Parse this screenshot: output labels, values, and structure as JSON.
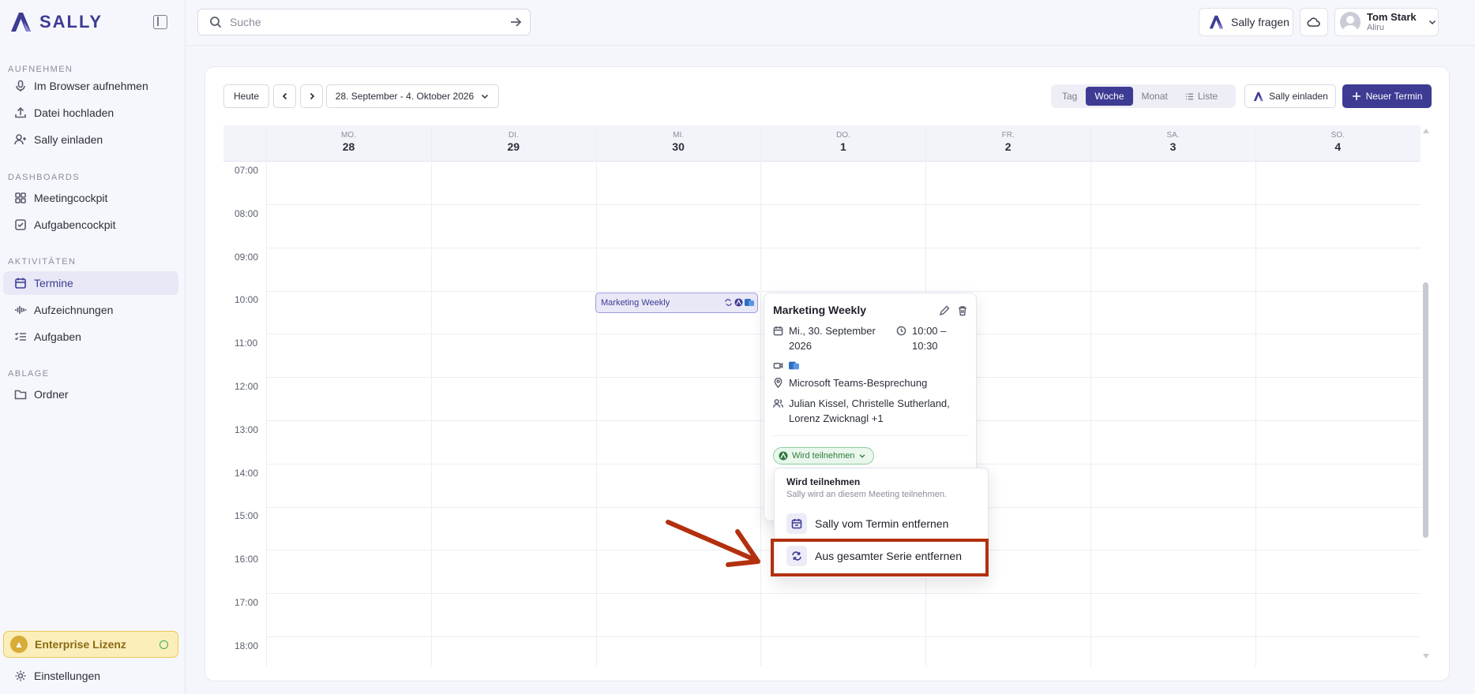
{
  "app": {
    "logo_text": "SALLY",
    "brand_color": "#3d3b93"
  },
  "sidebar": {
    "sections": [
      {
        "label": "AUFNEHMEN",
        "items": [
          {
            "label": "Im Browser aufnehmen",
            "icon": "mic-icon"
          },
          {
            "label": "Datei hochladen",
            "icon": "upload-icon"
          },
          {
            "label": "Sally einladen",
            "icon": "user-plus-icon"
          }
        ]
      },
      {
        "label": "DASHBOARDS",
        "items": [
          {
            "label": "Meetingcockpit",
            "icon": "grid-icon"
          },
          {
            "label": "Aufgabencockpit",
            "icon": "check-square-icon"
          }
        ]
      },
      {
        "label": "AKTIVITÄTEN",
        "items": [
          {
            "label": "Termine",
            "icon": "calendar-icon",
            "active": true
          },
          {
            "label": "Aufzeichnungen",
            "icon": "waveform-icon"
          },
          {
            "label": "Aufgaben",
            "icon": "list-check-icon"
          }
        ]
      },
      {
        "label": "ABLAGE",
        "items": [
          {
            "label": "Ordner",
            "icon": "folder-icon"
          }
        ]
      }
    ],
    "license_label": "Enterprise Lizenz",
    "settings_label": "Einstellungen"
  },
  "topbar": {
    "search_placeholder": "Suche",
    "ask_label": "Sally fragen",
    "user_name": "Tom Stark",
    "user_org": "Aliru"
  },
  "toolbar": {
    "today_label": "Heute",
    "date_range": "28. September - 4. Oktober 2026",
    "views": [
      "Tag",
      "Woche",
      "Monat",
      "Liste"
    ],
    "active_view": "Woche",
    "invite_label": "Sally einladen",
    "new_label": "Neuer Termin"
  },
  "calendar": {
    "days": [
      {
        "name": "MO.",
        "num": "28"
      },
      {
        "name": "DI.",
        "num": "29"
      },
      {
        "name": "MI.",
        "num": "30"
      },
      {
        "name": "DO.",
        "num": "1"
      },
      {
        "name": "FR.",
        "num": "2"
      },
      {
        "name": "SA.",
        "num": "3"
      },
      {
        "name": "SO.",
        "num": "4"
      }
    ],
    "hours": [
      "07:00",
      "08:00",
      "09:00",
      "10:00",
      "11:00",
      "12:00",
      "13:00",
      "14:00",
      "15:00",
      "16:00",
      "17:00",
      "18:00"
    ],
    "event_title": "Marketing Weekly"
  },
  "popover": {
    "title": "Marketing Weekly",
    "date": "Mi., 30. September 2026",
    "time": "10:00 – 10:30",
    "location": "Microsoft Teams-Besprechung",
    "attendees": "Julian Kissel, Christelle Sutherland, Lorenz Zwicknagl +1",
    "status": "Wird teilnehmen"
  },
  "dropdown": {
    "header": "Wird teilnehmen",
    "subtext": "Sally wird an diesem Meeting teilnehmen.",
    "item1": "Sally vom Termin entfernen",
    "item2": "Aus gesamter Serie entfernen"
  },
  "colors": {
    "accent": "#3d3b93",
    "highlight_box": "#b3300e",
    "status_green": "#2d7a3d"
  }
}
